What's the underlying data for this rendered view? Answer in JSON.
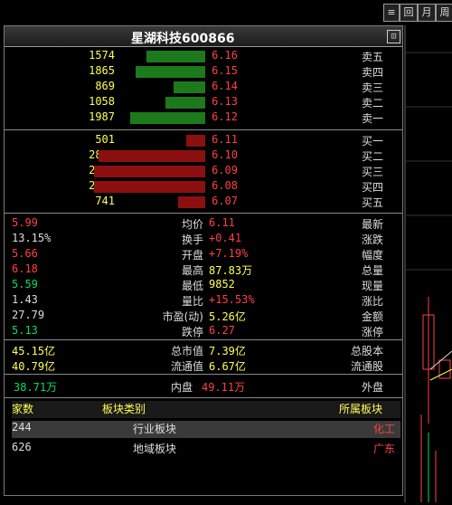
{
  "toolbar": {
    "btn1": "≡",
    "btn2": "回",
    "btn3": "月",
    "btn4": "周"
  },
  "header": {
    "title": "星湖科技600866",
    "icon": "⊡"
  },
  "sell_orders": [
    {
      "label": "卖五",
      "price": "6.16",
      "volume": "1574",
      "bar": 0.37
    },
    {
      "label": "卖四",
      "price": "6.15",
      "volume": "1865",
      "bar": 0.44
    },
    {
      "label": "卖三",
      "price": "6.14",
      "volume": "869",
      "bar": 0.2
    },
    {
      "label": "卖二",
      "price": "6.13",
      "volume": "1058",
      "bar": 0.25
    },
    {
      "label": "卖一",
      "price": "6.12",
      "volume": "1987",
      "bar": 0.47
    }
  ],
  "buy_orders": [
    {
      "label": "买一",
      "price": "6.11",
      "volume": "501",
      "bar": 0.12
    },
    {
      "label": "买二",
      "price": "6.10",
      "volume": "2845",
      "bar": 0.67
    },
    {
      "label": "买三",
      "price": "6.09",
      "volume": "2989",
      "bar": 0.7
    },
    {
      "label": "买四",
      "price": "6.08",
      "volume": "2980",
      "bar": 0.7
    },
    {
      "label": "买五",
      "price": "6.07",
      "volume": "741",
      "bar": 0.17
    }
  ],
  "stats": [
    {
      "l": "最新",
      "lv": "6.11",
      "r": "均价",
      "rv": "5.99"
    },
    {
      "l": "涨跌",
      "lv": "+0.41",
      "r": "换手",
      "rv": "13.15%"
    },
    {
      "l": "幅度",
      "lv": "+7.19%",
      "r": "开盘",
      "rv": "5.66"
    },
    {
      "l": "总量",
      "lv": "87.83万",
      "r": "最高",
      "rv": "6.18"
    },
    {
      "l": "现量",
      "lv": "9852",
      "r": "最低",
      "rv": "5.59"
    },
    {
      "l": "涨比",
      "lv": "+15.53%",
      "r": "量比",
      "rv": "1.43"
    },
    {
      "l": "金额",
      "lv": "5.26亿",
      "r": "市盈(动)",
      "rv": "27.79"
    },
    {
      "l": "涨停",
      "lv": "6.27",
      "r": "跌停",
      "rv": "5.13"
    }
  ],
  "capital": [
    {
      "l": "总股本",
      "lv": "7.39亿",
      "r": "总市值",
      "rv": "45.15亿"
    },
    {
      "l": "流通股",
      "lv": "6.67亿",
      "r": "流通值",
      "rv": "40.79亿"
    }
  ],
  "flow": {
    "out_label": "外盘",
    "out_val": "49.11万",
    "in_label": "内盘",
    "in_val": "38.71万"
  },
  "sectors": {
    "headers": [
      "所属板块",
      "板块类别",
      "家数"
    ],
    "rows": [
      {
        "name": "化工",
        "type": "行业板块",
        "count": "244"
      },
      {
        "name": "广东",
        "type": "地域板块",
        "count": "626"
      }
    ]
  },
  "colors": {
    "up": "#ff4040",
    "down": "#00e060",
    "volume": "#ffff55",
    "sell_bar": "#1c7a1c",
    "buy_bar": "#8c1010"
  }
}
